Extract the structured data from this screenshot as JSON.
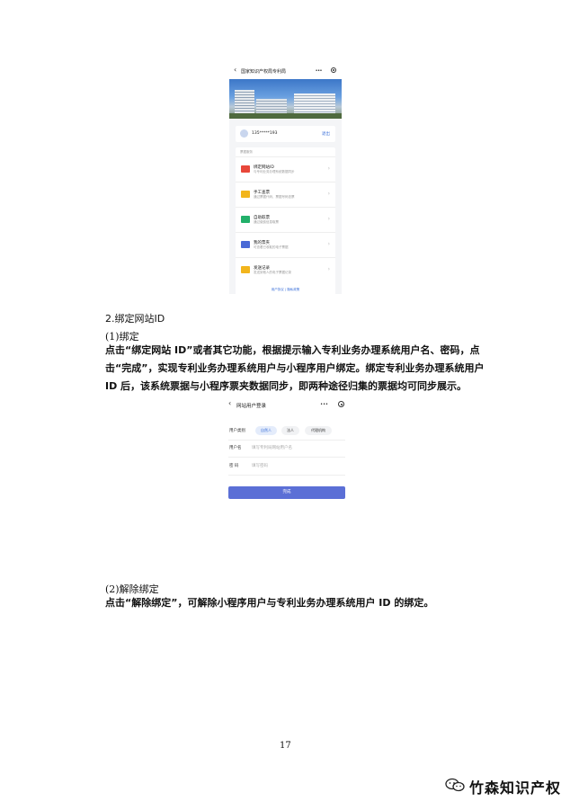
{
  "screenshot1": {
    "nav_title": "国家知识产权局专利局",
    "nav_more": "•••",
    "user_phone": "135*****193",
    "logout_label": "退出",
    "section_title": "票据服务",
    "menu_items": [
      {
        "name": "绑定网站ID",
        "desc": "与专利业务办理系统数据同步",
        "icon": "id-card-icon",
        "color": "#e8473a"
      },
      {
        "name": "手工查票",
        "desc": "通过票据代码、票据号码查票",
        "icon": "pen-note-icon",
        "color": "#f2b51c"
      },
      {
        "name": "自助取票",
        "desc": "通过缴费信息取票",
        "icon": "card-icon",
        "color": "#22b06a"
      },
      {
        "name": "我的票夹",
        "desc": "可查看已收取的电子票据",
        "icon": "folder-icon",
        "color": "#4a6ad6"
      },
      {
        "name": "发送记录",
        "desc": "发送到他人的电子票据记录",
        "icon": "record-icon",
        "color": "#f2b51c"
      }
    ],
    "footer_text": "用户协议 | 隐私政策"
  },
  "section_heading": "2.绑定网站ID",
  "sub1": "(1)绑定",
  "para1": "点击“绑定网站 ID”或者其它功能，根据提示输入专利业务办理系统用户名、密码，点击“完成”，实现专利业务办理系统用户与小程序用户绑定。绑定专利业务办理系统用户 ID 后，该系统票据与小程序票夹数据同步，即两种途径归集的票据均可同步展示。",
  "screenshot2": {
    "nav_title": "网站用户登录",
    "nav_more": "•••",
    "user_type_label": "用户类别",
    "user_types": [
      "自然人",
      "法人",
      "代理机构"
    ],
    "username_label": "用户名",
    "username_placeholder": "填写专利局网站用户名",
    "password_label": "密 码",
    "password_placeholder": "填写密码",
    "submit_label": "完成"
  },
  "sub2": "(2)解除绑定",
  "para2": "点击“解除绑定”，可解除小程序用户与专利业务办理系统用户 ID 的绑定。",
  "page_number": "17",
  "watermark_text": "竹森知识产权"
}
